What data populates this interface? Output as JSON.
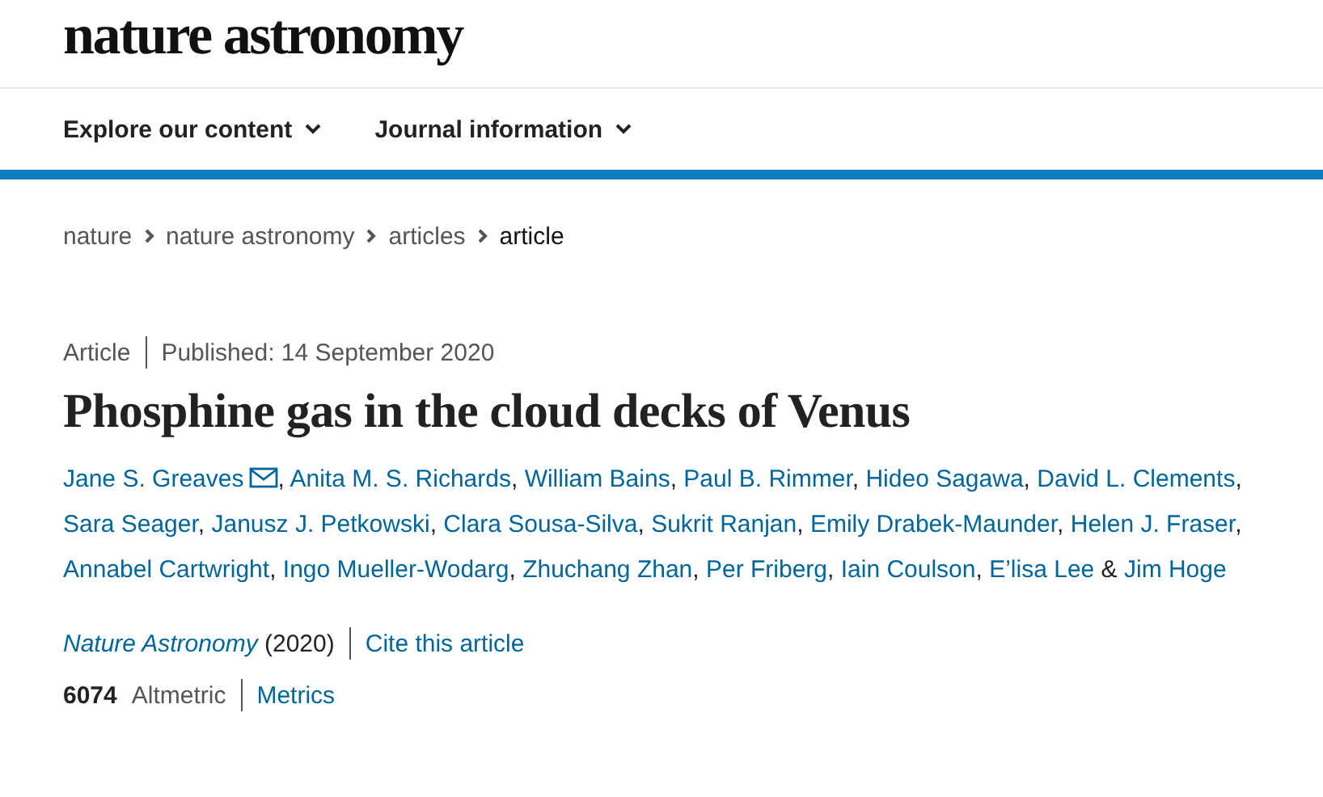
{
  "logo": "nature astronomy",
  "nav": [
    {
      "label": "Explore our content",
      "expanded": false
    },
    {
      "label": "Journal information",
      "expanded": false
    }
  ],
  "breadcrumb": [
    {
      "label": "nature",
      "current": false
    },
    {
      "label": "nature astronomy",
      "current": false
    },
    {
      "label": "articles",
      "current": false
    },
    {
      "label": "article",
      "current": true
    }
  ],
  "article_type": "Article",
  "published": "Published: 14 September 2020",
  "title": "Phosphine gas in the cloud decks of Venus",
  "authors": [
    {
      "name": "Jane S. Greaves",
      "corresponding": true
    },
    {
      "name": "Anita M. S. Richards",
      "corresponding": false
    },
    {
      "name": "William Bains",
      "corresponding": false
    },
    {
      "name": "Paul B. Rimmer",
      "corresponding": false
    },
    {
      "name": "Hideo Sagawa",
      "corresponding": false
    },
    {
      "name": "David L. Clements",
      "corresponding": false
    },
    {
      "name": "Sara Seager",
      "corresponding": false
    },
    {
      "name": "Janusz J. Petkowski",
      "corresponding": false
    },
    {
      "name": "Clara Sousa-Silva",
      "corresponding": false
    },
    {
      "name": "Sukrit Ranjan",
      "corresponding": false
    },
    {
      "name": "Emily Drabek-Maunder",
      "corresponding": false
    },
    {
      "name": "Helen J. Fraser",
      "corresponding": false
    },
    {
      "name": "Annabel Cartwright",
      "corresponding": false
    },
    {
      "name": "Ingo Mueller-Wodarg",
      "corresponding": false
    },
    {
      "name": "Zhuchang Zhan",
      "corresponding": false
    },
    {
      "name": "Per Friberg",
      "corresponding": false
    },
    {
      "name": "Iain Coulson",
      "corresponding": false
    },
    {
      "name": "E’lisa Lee",
      "corresponding": false
    },
    {
      "name": "Jim Hoge",
      "corresponding": false
    }
  ],
  "separators": [
    ",",
    "&"
  ],
  "journal": "Nature Astronomy",
  "year": "(2020)",
  "cite": "Cite this article",
  "altmetric_score": "6074",
  "altmetric_label": "Altmetric",
  "metrics": "Metrics"
}
